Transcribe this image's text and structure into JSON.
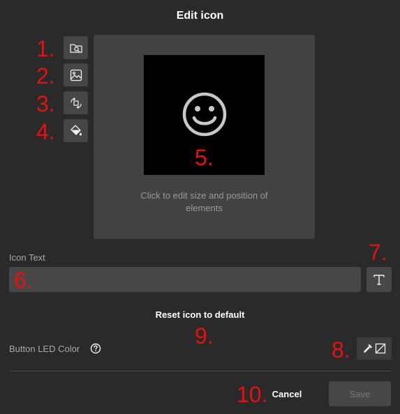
{
  "dialog": {
    "title": "Edit icon"
  },
  "toolbar": {
    "buttons": [
      {
        "icon": "search-folder-icon"
      },
      {
        "icon": "image-icon"
      },
      {
        "icon": "swap-icon"
      },
      {
        "icon": "paint-bucket-icon"
      }
    ]
  },
  "preview": {
    "hint": "Click to edit size and position of elements",
    "icon": "smiley-face-icon"
  },
  "icon_text": {
    "label": "Icon Text",
    "value": "",
    "placeholder": ""
  },
  "reset": {
    "label": "Reset icon to default"
  },
  "led": {
    "label": "Button LED Color"
  },
  "footer": {
    "cancel_label": "Cancel",
    "save_label": "Save"
  },
  "annotations": {
    "n1": "1.",
    "n2": "2.",
    "n3": "3.",
    "n4": "4.",
    "n5": "5.",
    "n6": "6.",
    "n7": "7.",
    "n8": "8.",
    "n9": "9.",
    "n10": "10."
  },
  "colors": {
    "background": "#2a2a2a",
    "panel": "#424242",
    "annotation": "#e81010",
    "button": "#464646"
  }
}
